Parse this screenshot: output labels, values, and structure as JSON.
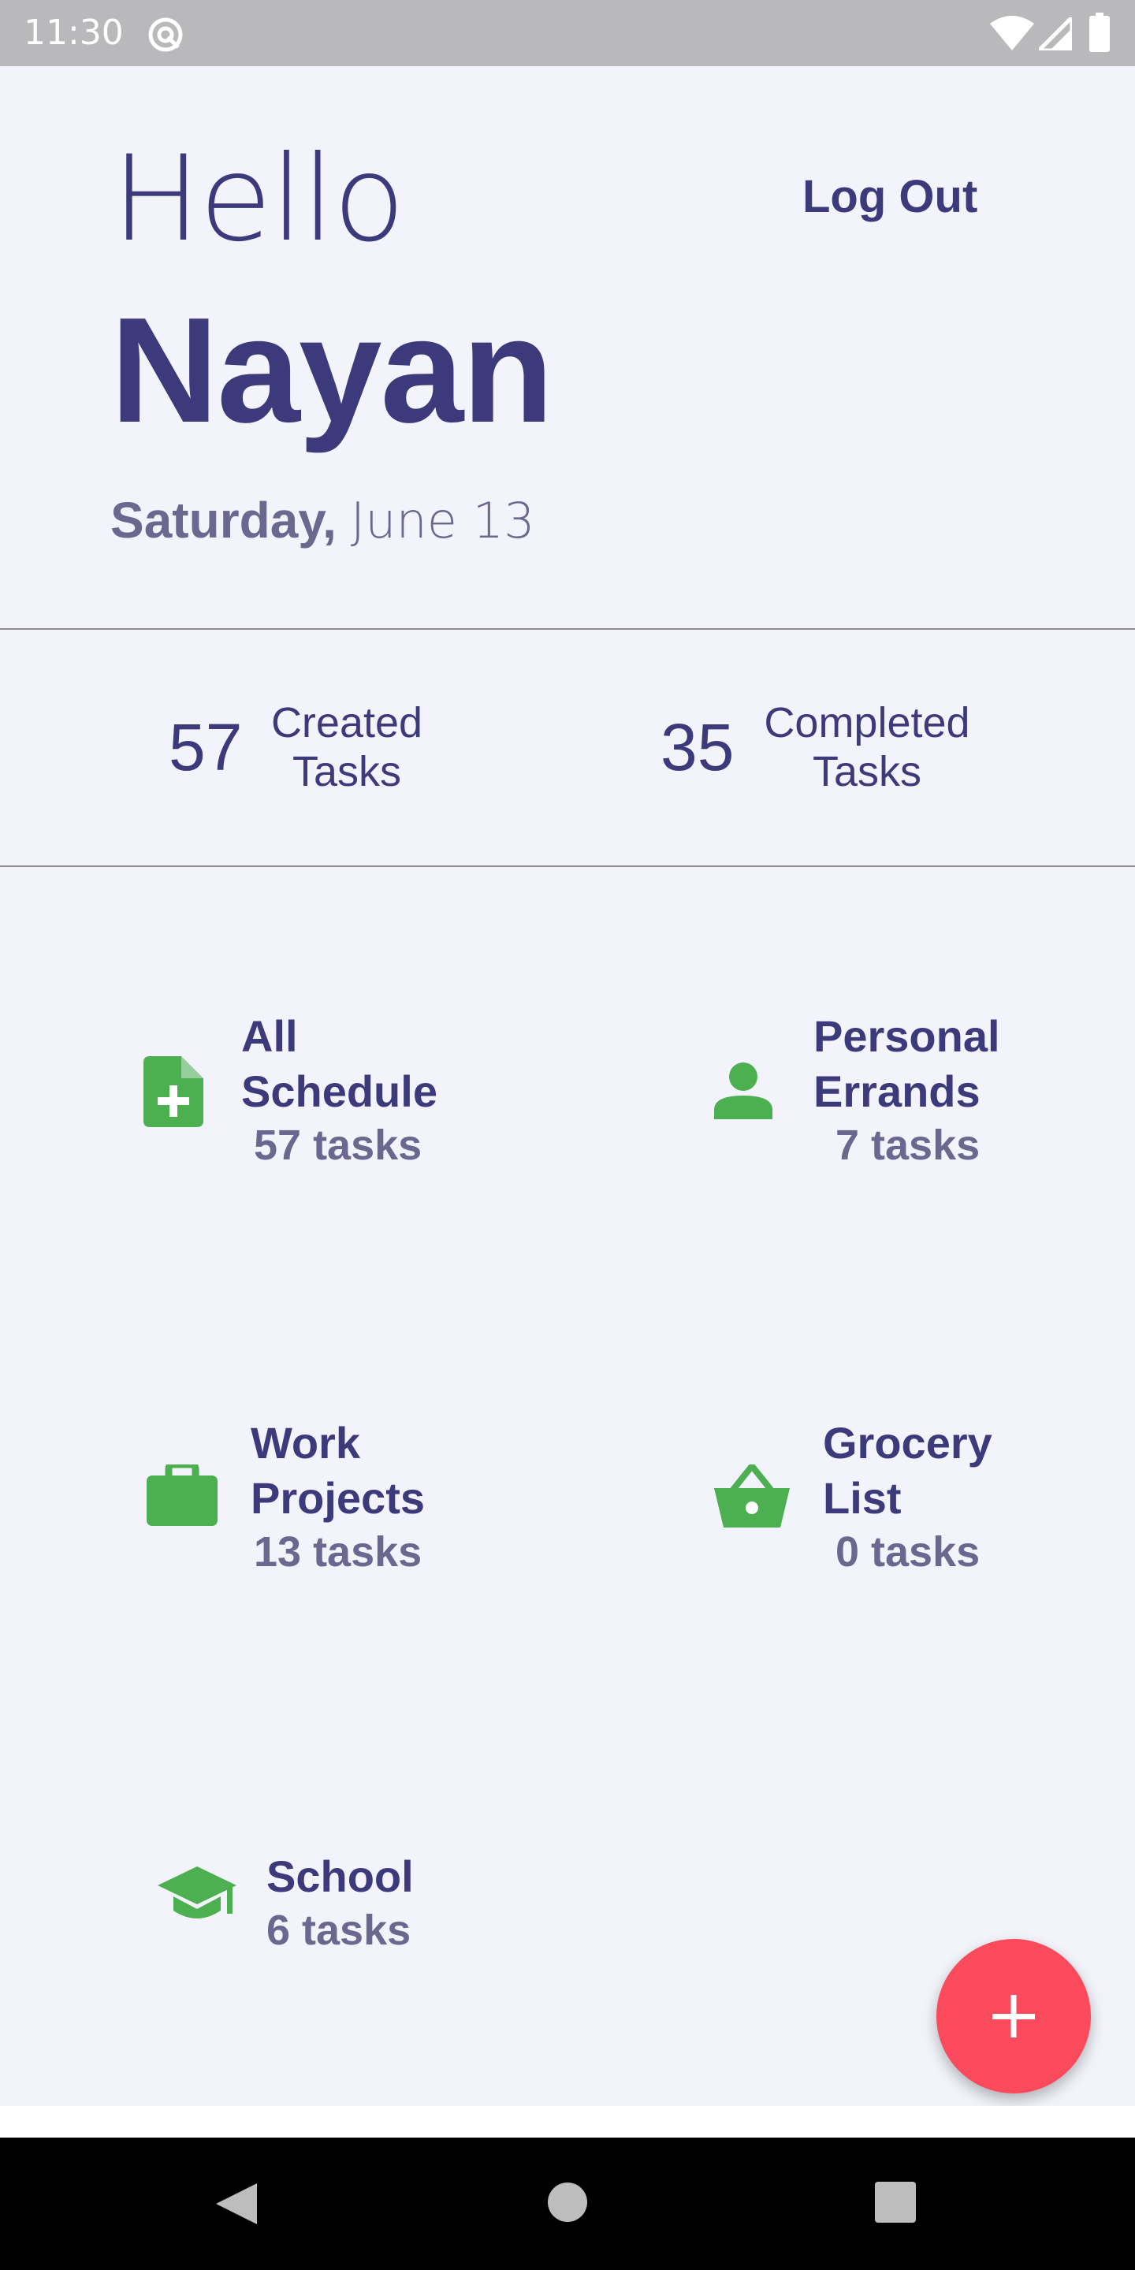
{
  "status_bar": {
    "time": "11:30",
    "icons": [
      "sync-icon",
      "wifi-icon",
      "signal-icon",
      "battery-icon"
    ]
  },
  "header": {
    "greeting": "Hello",
    "user_name": "Nayan",
    "logout_label": "Log Out",
    "date_day": "Saturday,",
    "date_rest": "June 13"
  },
  "stats": {
    "created": {
      "count": "57",
      "label_line1": "Created",
      "label_line2": "Tasks"
    },
    "completed": {
      "count": "35",
      "label_line1": "Completed",
      "label_line2": "Tasks"
    }
  },
  "categories": [
    {
      "title_line1": "All",
      "title_line2": "Schedule",
      "count": "57 tasks",
      "icon": "add-document-icon"
    },
    {
      "title_line1": "Personal",
      "title_line2": "Errands",
      "count": "7 tasks",
      "icon": "person-icon"
    },
    {
      "title_line1": "Work",
      "title_line2": "Projects",
      "count": "13 tasks",
      "icon": "briefcase-icon"
    },
    {
      "title_line1": "Grocery",
      "title_line2": "List",
      "count": "0 tasks",
      "icon": "basket-icon"
    },
    {
      "title_line1": "School",
      "title_line2": "",
      "count": "6 tasks",
      "icon": "graduation-cap-icon"
    }
  ],
  "fab": {
    "icon": "plus-icon"
  },
  "colors": {
    "primary_text": "#3d3a7c",
    "secondary_text": "#6b6890",
    "icon_green": "#4caf50",
    "fab_red": "#fb4a5b",
    "background": "#f3f4fb"
  }
}
